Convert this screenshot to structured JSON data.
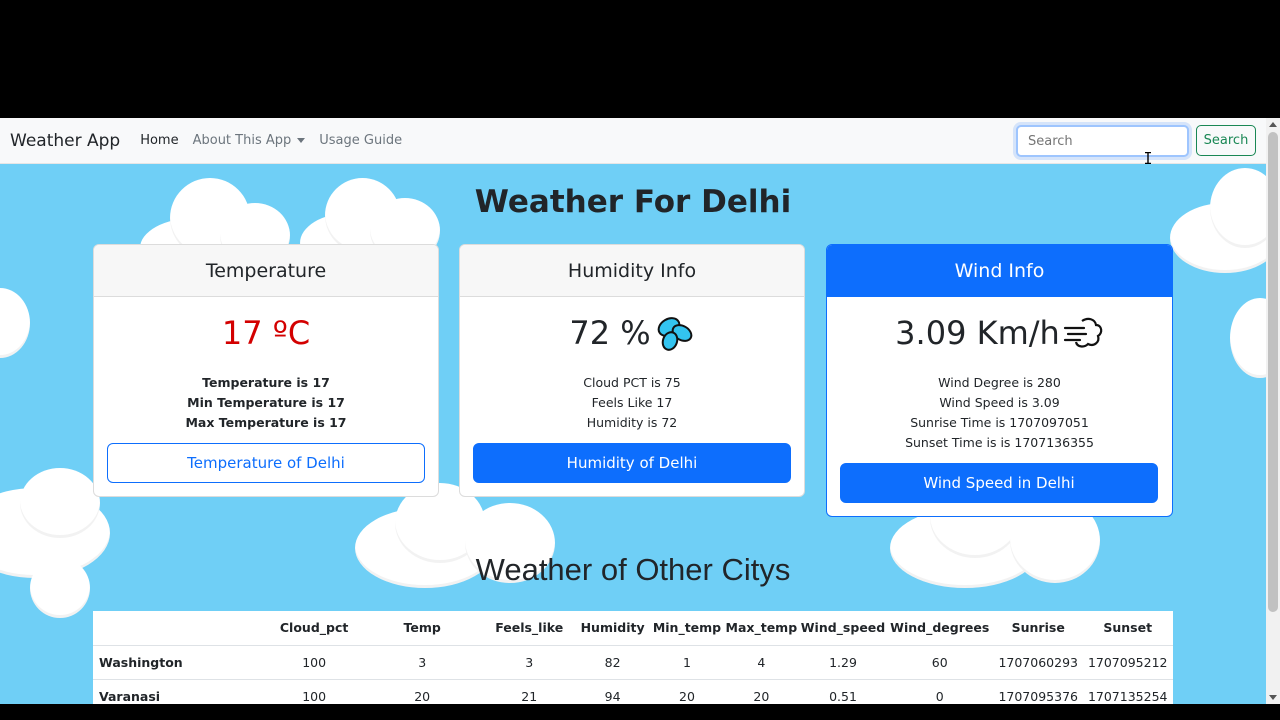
{
  "navbar": {
    "brand": "Weather App",
    "links": [
      {
        "label": "Home"
      },
      {
        "label": "About This App"
      },
      {
        "label": "Usage Guide"
      }
    ],
    "search_placeholder": "Search",
    "search_button": "Search"
  },
  "page_title": "Weather For Delhi",
  "cards": {
    "temperature": {
      "header": "Temperature",
      "value": "17 ºC",
      "lines": [
        "Temperature is 17",
        "Min Temperature is 17",
        "Max Temperature is 17"
      ],
      "button": "Temperature of Delhi"
    },
    "humidity": {
      "header": "Humidity Info",
      "value": "72 %",
      "lines": [
        "Cloud PCT is 75",
        "Feels Like 17",
        "Humidity is 72"
      ],
      "button": "Humidity of Delhi"
    },
    "wind": {
      "header": "Wind Info",
      "value": "3.09 Km/h",
      "lines": [
        "Wind Degree is 280",
        "Wind Speed is 3.09",
        "Sunrise Time is 1707097051",
        "Sunset Time is is 1707136355"
      ],
      "button": "Wind Speed in Delhi"
    }
  },
  "other_cities": {
    "title": "Weather of Other Citys",
    "headers": [
      "",
      "Cloud_pct",
      "Temp",
      "Feels_like",
      "Humidity",
      "Min_temp",
      "Max_temp",
      "Wind_speed",
      "Wind_degrees",
      "Sunrise",
      "Sunset"
    ],
    "rows": [
      [
        "Washington",
        "100",
        "3",
        "3",
        "82",
        "1",
        "4",
        "1.29",
        "60",
        "1707060293",
        "1707095212"
      ],
      [
        "Varanasi",
        "100",
        "20",
        "21",
        "94",
        "20",
        "20",
        "0.51",
        "0",
        "1707095376",
        "1707135254"
      ]
    ]
  },
  "colors": {
    "sky": "#6fcff6",
    "primary": "#0d6efd",
    "temperature_value": "#d30000",
    "search_button": "#198754"
  },
  "icons": {
    "humidity": "droplets-icon",
    "wind": "wind-icon"
  }
}
